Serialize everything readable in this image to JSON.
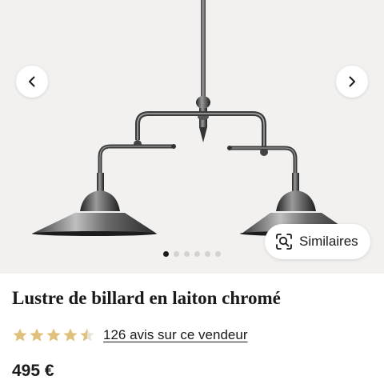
{
  "gallery": {
    "image_subject": "chrome billiard pendant lamp with two shades",
    "total_images": 6,
    "active_index": 0,
    "prev_icon": "chevron-left-icon",
    "next_icon": "chevron-right-icon",
    "similar_label": "Similaires",
    "similar_icon": "visual-search-icon"
  },
  "product": {
    "title": "Lustre de billard en laiton chromé",
    "rating": 4.5,
    "rating_max": 5,
    "reviews_link": "126 avis sur ce vendeur",
    "price": "495 €"
  },
  "colors": {
    "star": "#e0c07d",
    "star_empty": "#e8e3d8",
    "text": "#1a1a1a",
    "gallery_bg": "#f2f1ef"
  }
}
